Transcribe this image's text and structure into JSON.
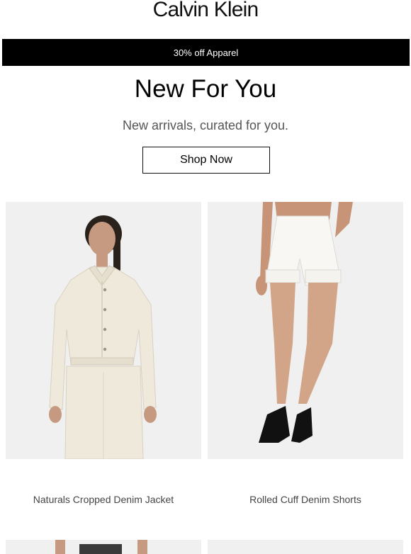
{
  "brand": {
    "logo_text": "Calvin Klein"
  },
  "promo": {
    "text": "30% off Apparel"
  },
  "hero": {
    "headline": "New For You",
    "subhead": "New arrivals, curated for you.",
    "cta_label": "Shop Now"
  },
  "products": [
    {
      "name": "Naturals Cropped Denim Jacket"
    },
    {
      "name": "Rolled Cuff Denim Shorts"
    }
  ],
  "colors": {
    "promo_bg": "#000000",
    "image_bg": "#f0f0f1",
    "garment": "#efe9dc"
  }
}
